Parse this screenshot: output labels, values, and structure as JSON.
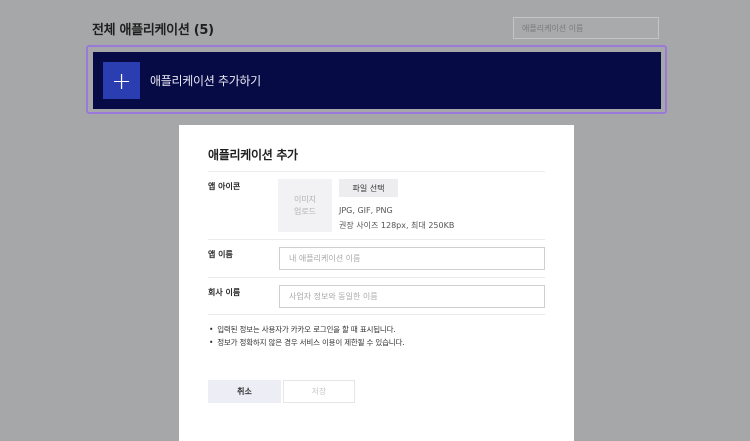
{
  "header": {
    "title": "전체 애플리케이션 (5)",
    "search_placeholder": "애플리케이션 이름"
  },
  "add_banner": {
    "icon": "plus-icon",
    "label": "애플리케이션 추가하기"
  },
  "modal": {
    "title": "애플리케이션 추가",
    "app_icon": {
      "label": "앱 아이콘",
      "placeholder_line1": "이미지",
      "placeholder_line2": "업로드",
      "file_button": "파일 선택",
      "formats": "JPG, GIF, PNG",
      "size_hint": "권장 사이즈 128px, 최대 250KB"
    },
    "app_name": {
      "label": "앱 이름",
      "placeholder": "내 애플리케이션 이름",
      "value": ""
    },
    "company_name": {
      "label": "회사 이름",
      "placeholder": "사업자 정보와 동일한 이름",
      "value": ""
    },
    "notices": [
      "입력된 정보는 사용자가 카카오 로그인을 할 때 표시됩니다.",
      "정보가 정확하지 않은 경우 서비스 이용이 제한될 수 있습니다."
    ],
    "cancel_label": "취소",
    "save_label": "저장"
  },
  "colors": {
    "banner_bg": "#060a45",
    "plus_box": "#2a3eb1",
    "banner_border": "#9a79db",
    "overlay": "#a6a7a9"
  }
}
